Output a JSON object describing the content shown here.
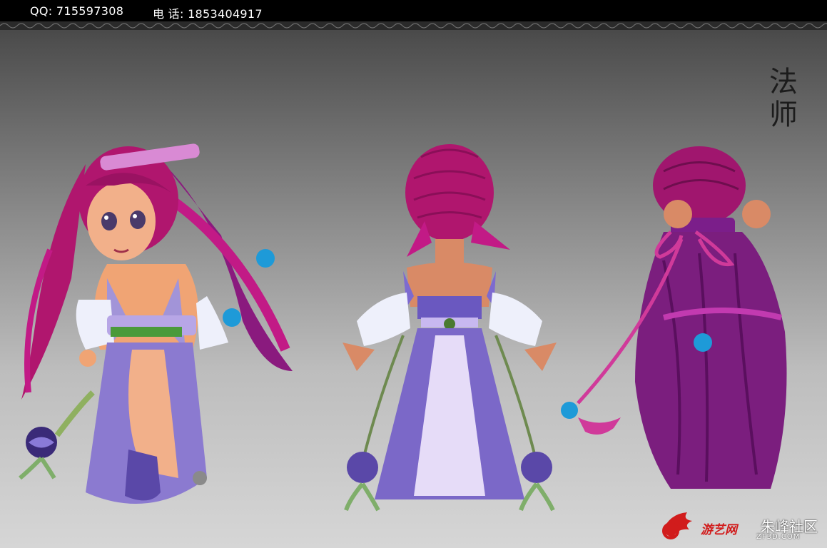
{
  "header": {
    "qq": "QQ: 715597308",
    "phone": "电  话: 1853404917"
  },
  "sheet": {
    "title": "法师"
  },
  "watermark": {
    "brand": "游艺网",
    "community": "朱峰社区",
    "url": "ZF3D.COM"
  },
  "colors": {
    "hair": "#b0166e",
    "robe": "#8b7ad0",
    "accent_green": "#4a9a3a",
    "bead": "#1e9ad8",
    "background_top": "#3c3c3c",
    "background_bottom": "#d6d6d6"
  }
}
